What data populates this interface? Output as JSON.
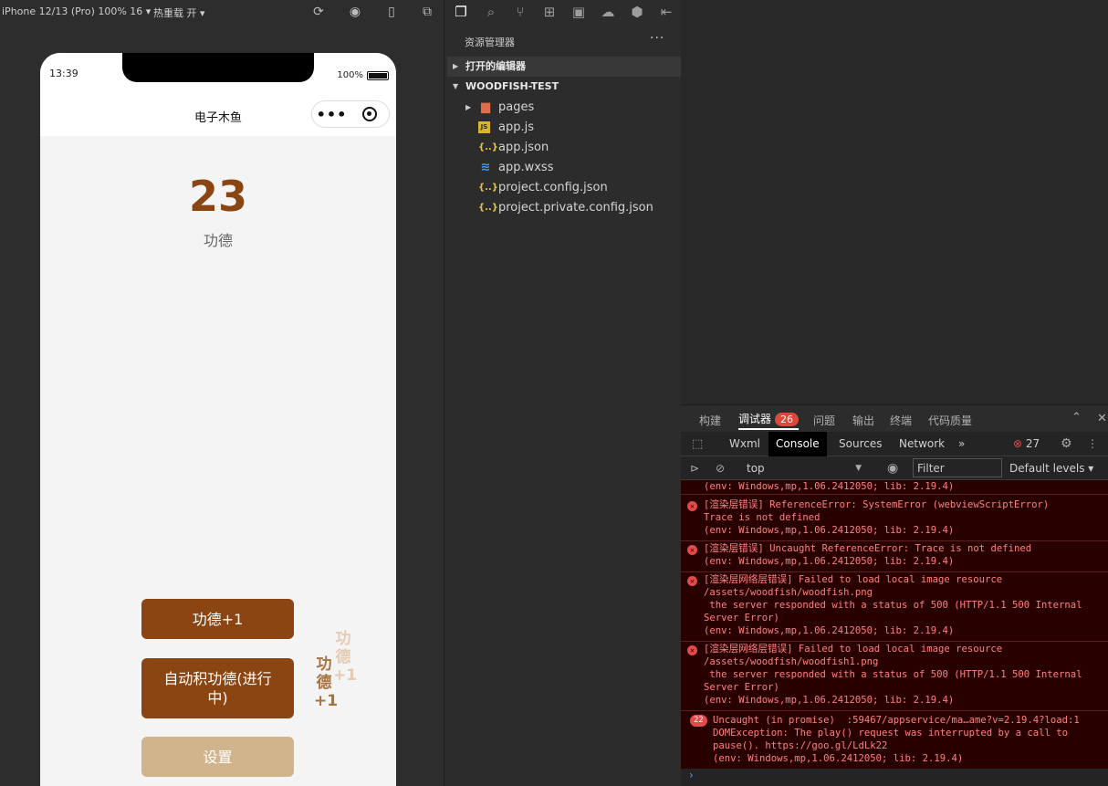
{
  "simulator": {
    "device": "iPhone 12/13 (Pro) 100% 16",
    "hot_reload": "热重载 开",
    "status_time": "13:39",
    "battery_text": "100%",
    "nav_title": "电子木鱼",
    "capsule_dots": "•••",
    "merit_count": "23",
    "merit_label": "功德",
    "btn_merit": "功德+1",
    "btn_auto": "自动积功德(进行中)",
    "btn_settings": "设置",
    "float_a": [
      "功",
      "德",
      "+1"
    ],
    "float_b": [
      "功",
      "德",
      "+1"
    ],
    "colors": {
      "primary": "#8b4513",
      "secondary": "#d2b48c",
      "float_light": "#e3cbb4",
      "float_dark": "#a8713f"
    }
  },
  "explorer": {
    "title": "资源管理器",
    "more": "···",
    "open_editors": "打开的编辑器",
    "project": "WOODFISH-TEST",
    "files": [
      {
        "name": "pages",
        "icon": "folder-icon"
      },
      {
        "name": "app.js",
        "icon": "js-file-icon"
      },
      {
        "name": "app.json",
        "icon": "json-file-icon"
      },
      {
        "name": "app.wxss",
        "icon": "css-file-icon"
      },
      {
        "name": "project.config.json",
        "icon": "json-file-icon"
      },
      {
        "name": "project.private.config.json",
        "icon": "json-file-icon"
      }
    ]
  },
  "devtools": {
    "tabs": [
      "构建",
      "调试器",
      "问题",
      "输出",
      "终端",
      "代码质量"
    ],
    "debugger_badge": "26",
    "console_tabs": [
      "Wxml",
      "Console",
      "Sources",
      "Network"
    ],
    "more_tabs": "»",
    "error_count": "27",
    "context": "top",
    "filter_placeholder": "Filter",
    "levels": "Default levels",
    "entries": [
      {
        "text": "(env: Windows,mp,1.06.2412050; lib: 2.19.4)"
      },
      {
        "text": "[渲染层错误] ReferenceError: SystemError (webviewScriptError)\nTrace is not defined\n(env: Windows,mp,1.06.2412050; lib: 2.19.4)"
      },
      {
        "text": "[渲染层错误] Uncaught ReferenceError: Trace is not defined\n(env: Windows,mp,1.06.2412050; lib: 2.19.4)"
      },
      {
        "text": "[渲染层网络层错误] Failed to load local image resource\n/assets/woodfish/woodfish.png\n the server responded with a status of 500 (HTTP/1.1 500 Internal\nServer Error)\n(env: Windows,mp,1.06.2412050; lib: 2.19.4)"
      },
      {
        "text": "[渲染层网络层错误] Failed to load local image resource\n/assets/woodfish/woodfish1.png\n the server responded with a status of 500 (HTTP/1.1 500 Internal\nServer Error)\n(env: Windows,mp,1.06.2412050; lib: 2.19.4)"
      },
      {
        "text": "Uncaught (in promise)  :59467/appservice/ma…ame?v=2.19.4?load:1\nDOMException: The play() request was interrupted by a call to\npause(). https://goo.gl/LdLk22\n(env: Windows,mp,1.06.2412050; lib: 2.19.4)",
        "count": "22"
      }
    ],
    "prompt": "›"
  }
}
